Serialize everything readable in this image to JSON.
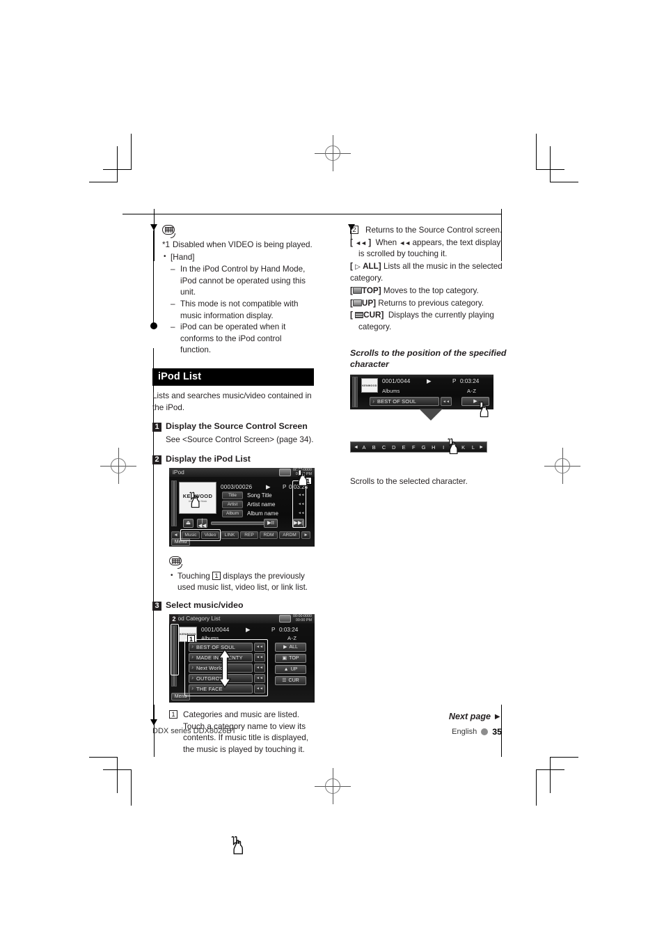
{
  "page": {
    "footer_left": "DDX series   DDX8026BT",
    "footer_next": "Next page ►",
    "footer_language": "English",
    "footer_page_number": "35"
  },
  "left_column": {
    "note_top": {
      "icon": "note-bubble-icon",
      "footnote": "Disabled when VIDEO is being played.",
      "footnote_marker": "*1",
      "bullet_label": "[Hand]",
      "dashes": [
        "In the iPod Control by Hand Mode, iPod cannot be operated using this unit.",
        "This mode is not compatible with music information display.",
        "iPod can be operated when it conforms to the iPod control function."
      ]
    },
    "section": {
      "title": "iPod List",
      "lead": "Lists and searches music/video contained in the iPod."
    },
    "steps": [
      {
        "num": "1",
        "title": "Display the Source Control Screen",
        "body": "See <Source Control Screen> (page 34)."
      },
      {
        "num": "2",
        "title": "Display the iPod List"
      },
      {
        "num": "3",
        "title": "Select music/video"
      }
    ],
    "note_mid": {
      "icon": "note-bubble-icon",
      "text_before": "Touching",
      "tag": "1",
      "text_after": "displays the previously used music list, video list, or link list."
    },
    "callout_bottom": {
      "tag": "1",
      "text": "Categories and music are listed. Touch a category name to view its contents. If music title is displayed, the music is played by touching it."
    }
  },
  "right_column": {
    "items": [
      {
        "key_type": "num",
        "key": "2",
        "desc": "Returns to the Source Control screen."
      },
      {
        "key_type": "glyph",
        "key": "[ ◄◄ ]",
        "desc": "When ◄◄ appears, the text display is scrolled by touching it."
      },
      {
        "key_type": "glyph",
        "key": "[ ▷ ALL]",
        "desc": "Lists all the music in the selected category."
      },
      {
        "key_type": "glyph",
        "key": "[TOP]",
        "desc": "Moves to the top category."
      },
      {
        "key_type": "glyph",
        "key": "[UP]",
        "desc": "Returns to previous category."
      },
      {
        "key_type": "glyph",
        "key": "[CUR]",
        "desc": "Displays the currently playing category."
      }
    ],
    "subhead": "Scrolls to the position of the specified character",
    "caption": "Scrolls to the selected character.",
    "alphabet": [
      "A",
      "B",
      "C",
      "D",
      "E",
      "F",
      "G",
      "H",
      "I",
      "J",
      "K",
      "L"
    ],
    "alpha_prev": "◄",
    "alpha_next": "►"
  },
  "screen_source_control": {
    "source_label": "iPod",
    "clock_line1": "00:00:0000",
    "clock_line2": "00:00 PM",
    "track_number": "0003/00026",
    "play_glyph": "▶",
    "time_prefix": "P",
    "time": "0:03:24",
    "rows": [
      {
        "label": "Title",
        "value": "Song Title"
      },
      {
        "label": "Artist",
        "value": "Artist name"
      },
      {
        "label": "Album",
        "value": "Album name"
      }
    ],
    "transport": [
      "⏏",
      "|◀◀",
      "▶II",
      "▶▶|"
    ],
    "function_buttons": [
      "Music",
      "Video",
      "LINK",
      "REP",
      "RDM",
      "ARDM"
    ],
    "menu_label": "Menu",
    "tag": "1"
  },
  "screen_category_list": {
    "title": "iPod Category List",
    "clock_line1": "00:00:0000",
    "clock_line2": "00:00 PM",
    "track_number": "0001/0044",
    "play_glyph": "▶",
    "time_prefix": "P",
    "time": "0:03:24",
    "category_label": "Albums",
    "az_label": "A-Z",
    "list_items": [
      "BEST OF SOUL",
      "MADE IN TWENTY",
      "Next World",
      "OUTGROW",
      "THE FACE"
    ],
    "side_buttons": [
      "ALL",
      "TOP",
      "UP",
      "CUR"
    ],
    "menu_label": "Menu",
    "tag_list": "1",
    "tag_return": "2"
  },
  "screen_az_small": {
    "track_number": "0001/0044",
    "play_glyph": "▶",
    "time_prefix": "P",
    "time": "0:03:24",
    "category_label": "Albums",
    "az_label": "A-Z",
    "list_item": "BEST OF SOUL"
  }
}
